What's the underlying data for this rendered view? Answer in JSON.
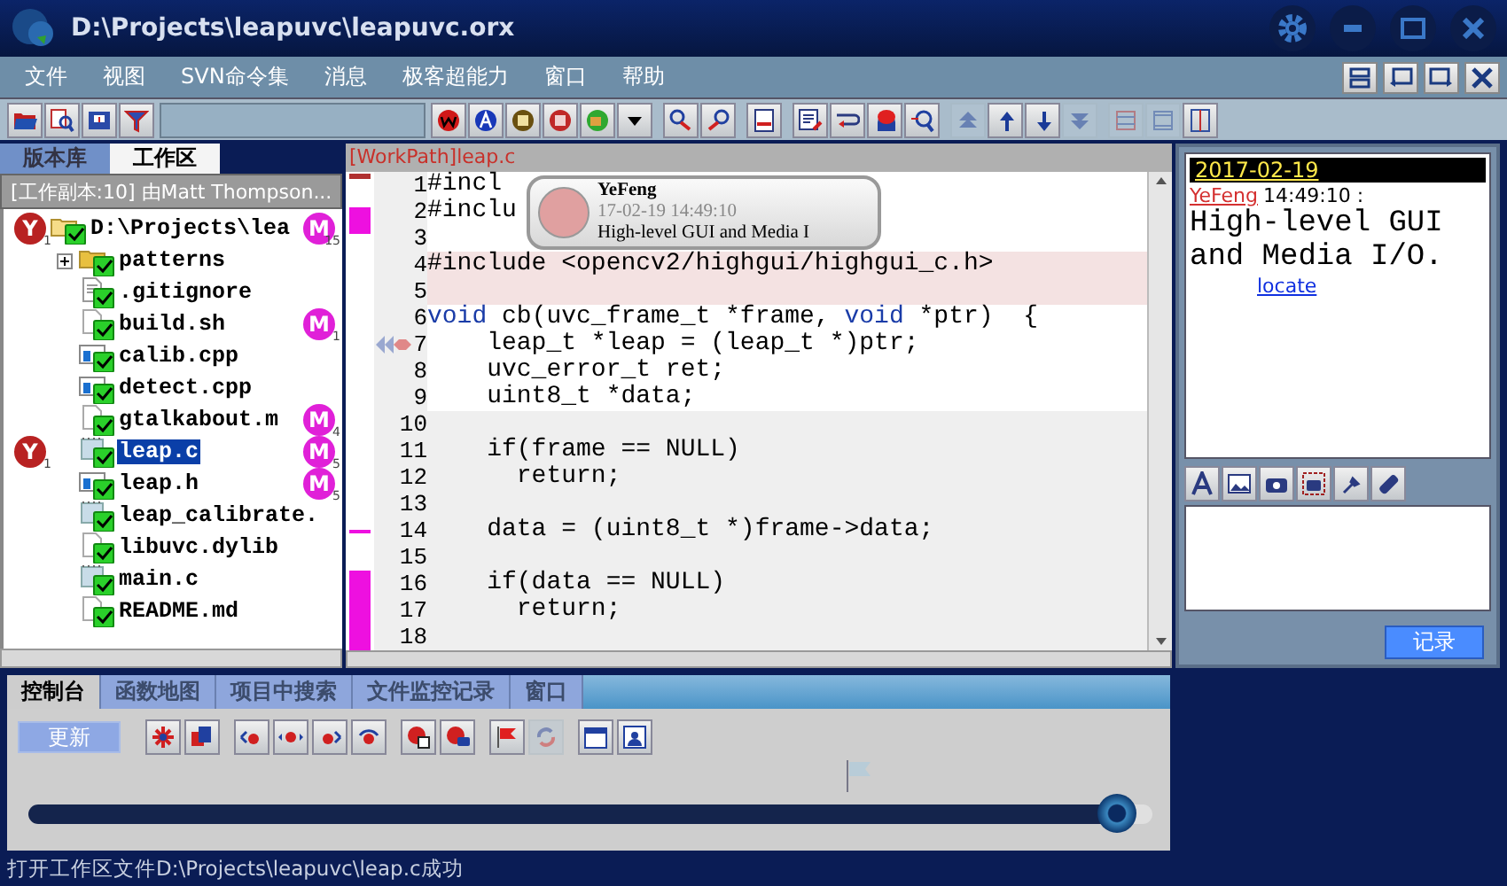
{
  "window": {
    "title": "D:\\Projects\\leapuvc\\leapuvc.orx"
  },
  "menu": [
    "文件",
    "视图",
    "SVN命令集",
    "消息",
    "极客超能力",
    "窗口",
    "帮助"
  ],
  "main_toolbar": [
    {
      "disabled": false
    },
    {
      "disabled": false
    },
    {
      "disabled": false
    },
    {
      "disabled": false
    },
    {
      "disabled": false
    },
    {
      "disabled": false
    },
    {
      "disabled": false
    },
    {
      "disabled": false
    },
    {
      "disabled": false
    },
    {
      "disabled": false
    },
    {
      "disabled": false
    },
    {
      "disabled": false
    },
    {
      "disabled": false
    },
    {
      "disabled": false
    },
    {
      "disabled": false
    },
    {
      "disabled": false
    },
    {
      "disabled": false
    },
    {
      "disabled": true
    },
    {
      "disabled": false
    },
    {
      "disabled": false
    },
    {
      "disabled": true
    },
    {
      "disabled": true
    },
    {
      "disabled": true
    },
    {
      "disabled": false
    }
  ],
  "left_panel": {
    "tabs": [
      {
        "label": "版本库",
        "selected": false
      },
      {
        "label": "工作区",
        "selected": true
      }
    ],
    "header": "[工作副本:10] 由Matt Thompson...",
    "tree": {
      "name": "D:\\Projects\\lea",
      "kind": "folder",
      "expanded": true,
      "selected": false,
      "y_badge": {
        "letter": "Y",
        "count": "1"
      },
      "m_badge": {
        "letter": "M",
        "count": "15"
      },
      "children": [
        {
          "name": "patterns",
          "kind": "folder",
          "expanded": false,
          "selected": false
        },
        {
          "name": ".gitignore",
          "kind": "text",
          "selected": false
        },
        {
          "name": "build.sh",
          "kind": "blank",
          "selected": false,
          "m_badge": {
            "letter": "M",
            "count": "1"
          }
        },
        {
          "name": "calib.cpp",
          "kind": "window",
          "selected": false
        },
        {
          "name": "detect.cpp",
          "kind": "window",
          "selected": false
        },
        {
          "name": "gtalkabout.m",
          "kind": "blank",
          "selected": false,
          "m_badge": {
            "letter": "M",
            "count": "4"
          }
        },
        {
          "name": "leap.c",
          "kind": "notepad",
          "selected": true,
          "y_badge": {
            "letter": "Y",
            "count": "1"
          },
          "m_badge": {
            "letter": "M",
            "count": "5"
          }
        },
        {
          "name": "leap.h",
          "kind": "window",
          "selected": false,
          "m_badge": {
            "letter": "M",
            "count": "5"
          }
        },
        {
          "name": "leap_calibrate.",
          "kind": "notepad",
          "selected": false
        },
        {
          "name": "libuvc.dylib",
          "kind": "blank",
          "selected": false
        },
        {
          "name": "main.c",
          "kind": "notepad",
          "selected": false
        },
        {
          "name": "README.md",
          "kind": "blank",
          "selected": false
        }
      ]
    }
  },
  "editor": {
    "tab": "[WorkPath]leap.c",
    "tooltip": {
      "author": "YeFeng",
      "time": "17-02-19 14:49:10",
      "message": "High-level GUI and Media I"
    },
    "lines": [
      {
        "number": "1",
        "modified": false,
        "in_block": true,
        "segments": [
          {
            "text": "#incl",
            "keyword": false
          }
        ]
      },
      {
        "number": "2",
        "modified": false,
        "in_block": true,
        "segments": [
          {
            "text": "#inclu",
            "keyword": false
          }
        ]
      },
      {
        "number": "3",
        "modified": false,
        "in_block": true
      },
      {
        "number": "4",
        "modified": true,
        "in_block": false,
        "segments": [
          {
            "text": "#include <opencv2/highgui/highgui_c.h>",
            "keyword": false
          }
        ]
      },
      {
        "number": "5",
        "modified": true,
        "in_block": false
      },
      {
        "number": "6",
        "modified": false,
        "in_block": true,
        "segments": [
          {
            "text": "void",
            "keyword": true
          },
          {
            "text": " cb(uvc_frame_t *frame, ",
            "keyword": false
          },
          {
            "text": "void",
            "keyword": true
          },
          {
            "text": " *ptr)  {",
            "keyword": false
          }
        ]
      },
      {
        "number": "7",
        "modified": false,
        "in_block": true,
        "segments": [
          {
            "text": "    leap_t *leap = (leap_t *)ptr;",
            "keyword": false
          }
        ]
      },
      {
        "number": "8",
        "modified": false,
        "in_block": true,
        "segments": [
          {
            "text": "    uvc_error_t ret;",
            "keyword": false
          }
        ]
      },
      {
        "number": "9",
        "modified": false,
        "in_block": true,
        "segments": [
          {
            "text": "    uint8_t *data;",
            "keyword": false
          }
        ]
      },
      {
        "number": "10",
        "modified": false,
        "in_block": false
      },
      {
        "number": "11",
        "modified": false,
        "in_block": false,
        "segments": [
          {
            "text": "    if(frame == NULL)",
            "keyword": false
          }
        ]
      },
      {
        "number": "12",
        "modified": false,
        "in_block": false,
        "segments": [
          {
            "text": "      return;",
            "keyword": false
          }
        ]
      },
      {
        "number": "13",
        "modified": false,
        "in_block": false
      },
      {
        "number": "14",
        "modified": false,
        "in_block": false,
        "segments": [
          {
            "text": "    data = (uint8_t *)frame->data;",
            "keyword": false
          }
        ]
      },
      {
        "number": "15",
        "modified": false,
        "in_block": false
      },
      {
        "number": "16",
        "modified": false,
        "in_block": false,
        "segments": [
          {
            "text": "    if(data == NULL)",
            "keyword": false
          }
        ]
      },
      {
        "number": "17",
        "modified": false,
        "in_block": false,
        "segments": [
          {
            "text": "      return;",
            "keyword": false
          }
        ]
      },
      {
        "number": "18",
        "modified": false,
        "in_block": false
      }
    ]
  },
  "chat": {
    "date": "2017-02-19",
    "author": "YeFeng",
    "time": "14:49:10 :",
    "message": "High-level GUI and Media I/O.",
    "link": "locate",
    "button": "记录"
  },
  "bottom_panel": {
    "tabs": [
      {
        "label": "控制台",
        "selected": true
      },
      {
        "label": "函数地图",
        "selected": false
      },
      {
        "label": "项目中搜索",
        "selected": false
      },
      {
        "label": "文件监控记录",
        "selected": false
      },
      {
        "label": "窗口",
        "selected": false
      }
    ],
    "update_button": "更新",
    "tools": [
      {
        "disabled": false
      },
      {
        "disabled": false
      },
      {
        "disabled": false
      },
      {
        "disabled": false
      },
      {
        "disabled": false
      },
      {
        "disabled": false
      },
      {
        "disabled": false
      },
      {
        "disabled": false
      },
      {
        "disabled": false
      },
      {
        "disabled": true
      },
      {
        "disabled": false
      },
      {
        "disabled": false
      }
    ],
    "timeline": {
      "level": 0.985
    }
  },
  "status_bar": "打开工作区文件D:\\Projects\\leapuvc\\leap.c成功"
}
